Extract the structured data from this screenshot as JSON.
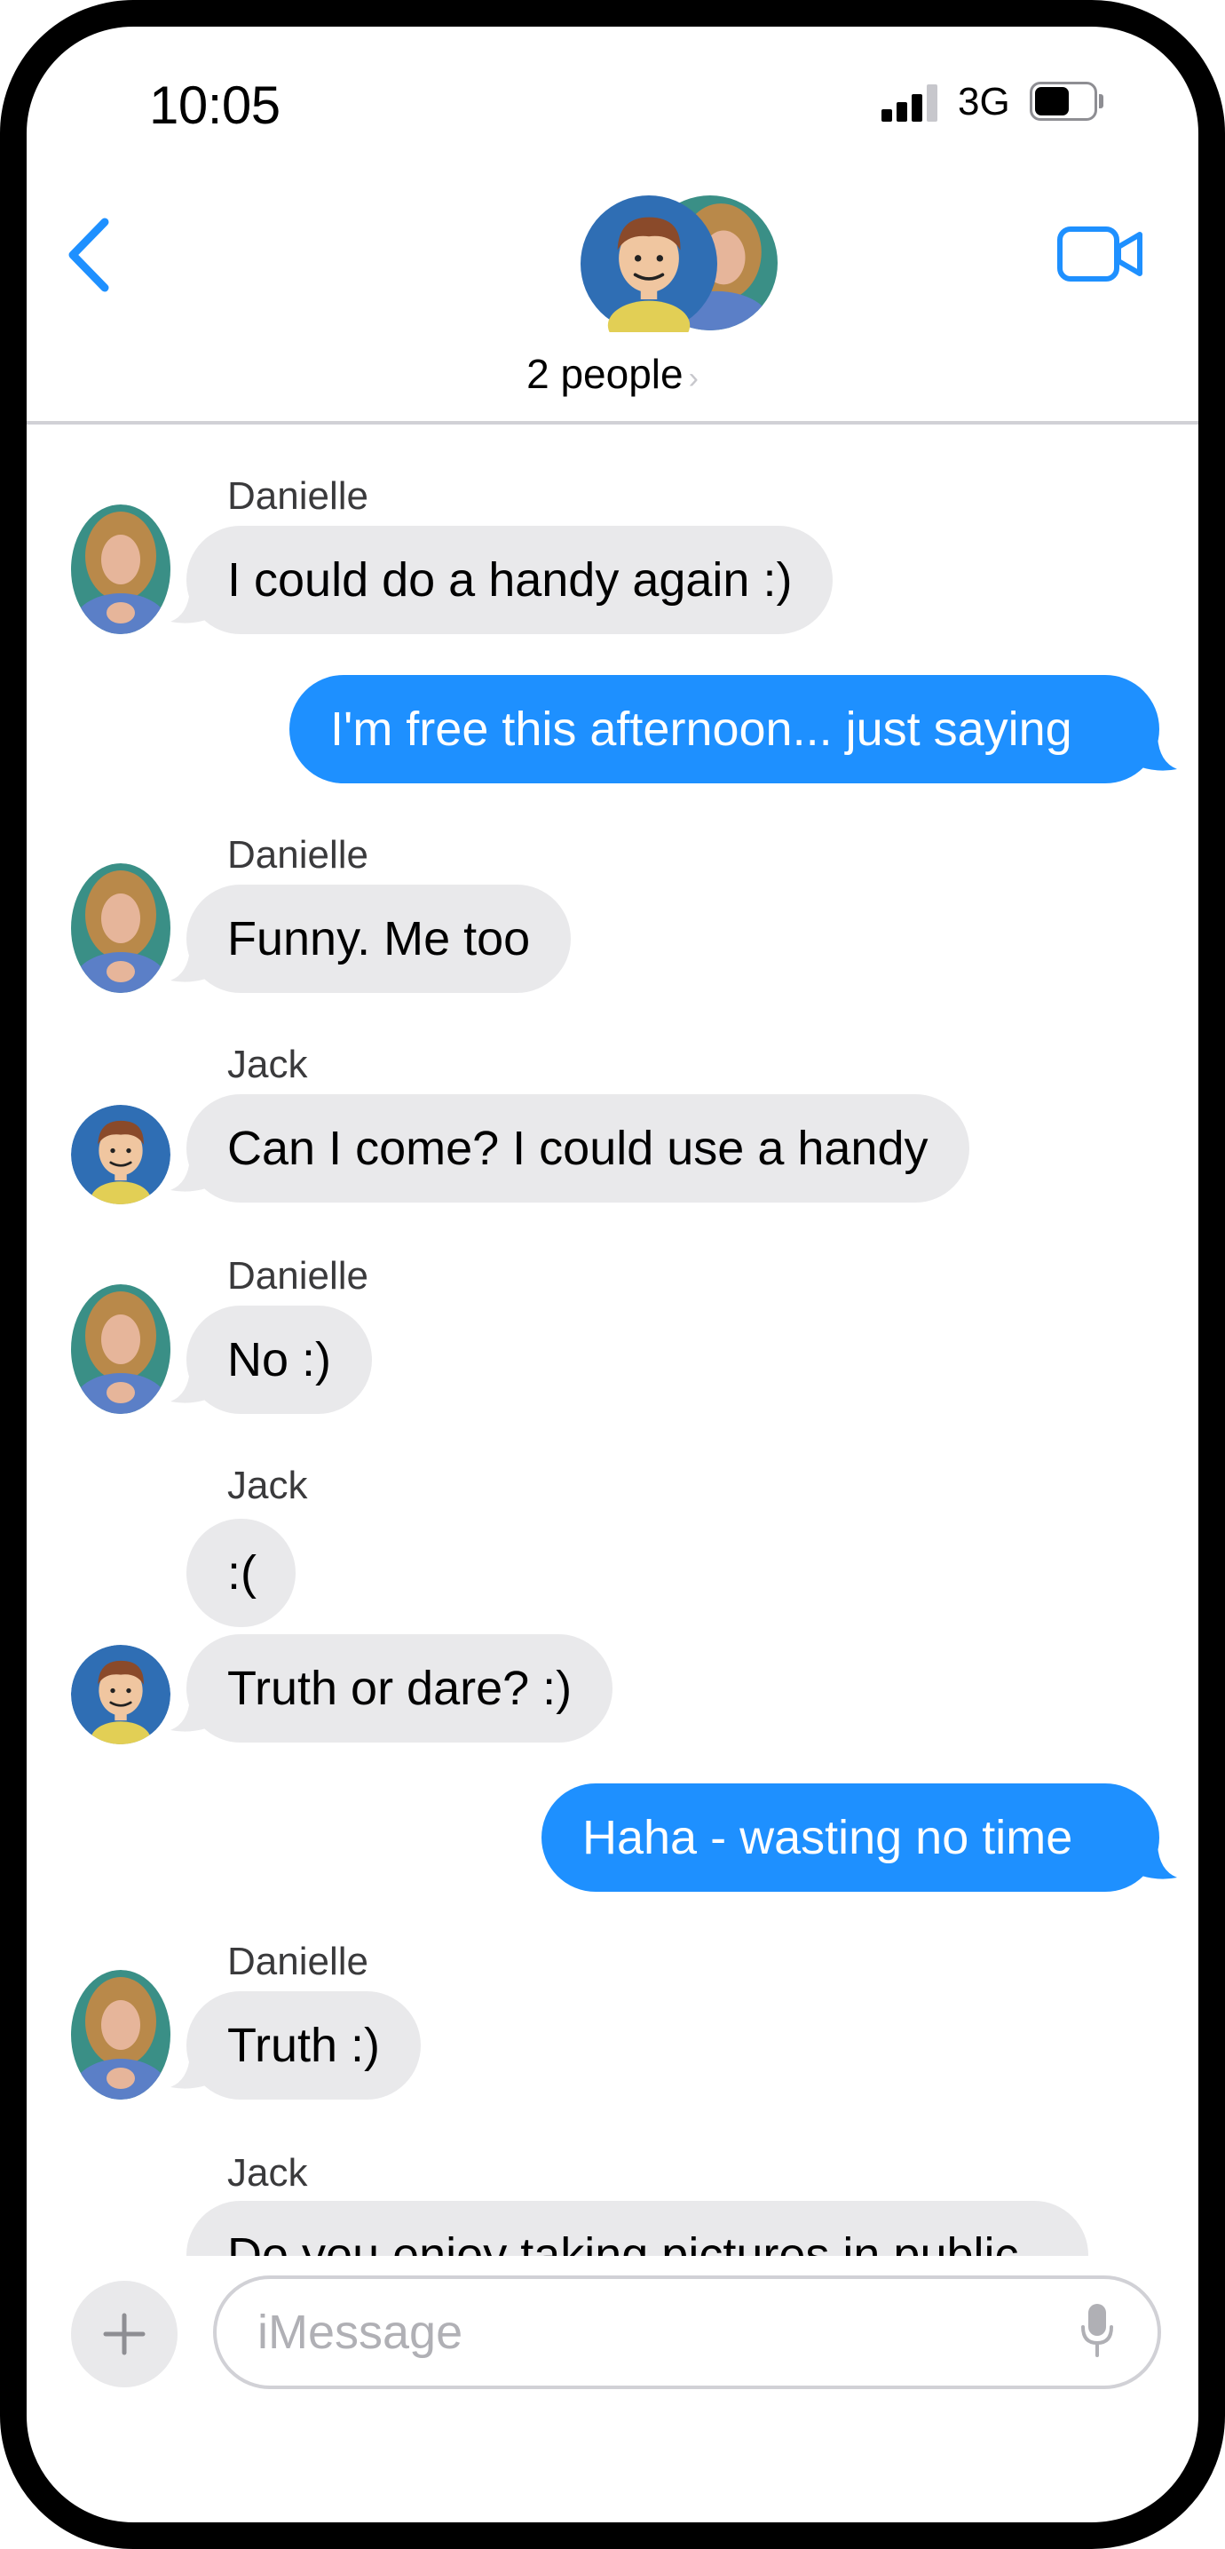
{
  "status_bar": {
    "time": "10:05",
    "network": "3G"
  },
  "header": {
    "people_label": "2 people",
    "chevron": "›"
  },
  "colors": {
    "accent": "#1e90ff",
    "incoming_bubble": "#e9e9eb",
    "frame": "#000000"
  },
  "messages": [
    {
      "sender": "Danielle",
      "text": "I could do a handy again :)",
      "direction": "in"
    },
    {
      "text": "I'm free this afternoon... just saying",
      "direction": "out"
    },
    {
      "sender": "Danielle",
      "text": "Funny.  Me too",
      "direction": "in"
    },
    {
      "sender": "Jack",
      "text": "Can I come?  I could use a handy",
      "direction": "in"
    },
    {
      "sender": "Danielle",
      "text": "No :)",
      "direction": "in"
    },
    {
      "sender": "Jack",
      "text": ":(",
      "direction": "in"
    },
    {
      "text": "Truth or dare? :)",
      "direction": "in"
    },
    {
      "text": "Haha - wasting no time",
      "direction": "out"
    },
    {
      "sender": "Danielle",
      "text": "Truth :)",
      "direction": "in"
    },
    {
      "sender": "Jack",
      "text": "Do you enjoy taking pictures in public",
      "direction": "in"
    }
  ],
  "input": {
    "placeholder": "iMessage"
  },
  "icons": {
    "back": "chevron-left-icon",
    "video": "video-camera-icon",
    "plus": "plus-icon",
    "mic": "microphone-icon"
  }
}
